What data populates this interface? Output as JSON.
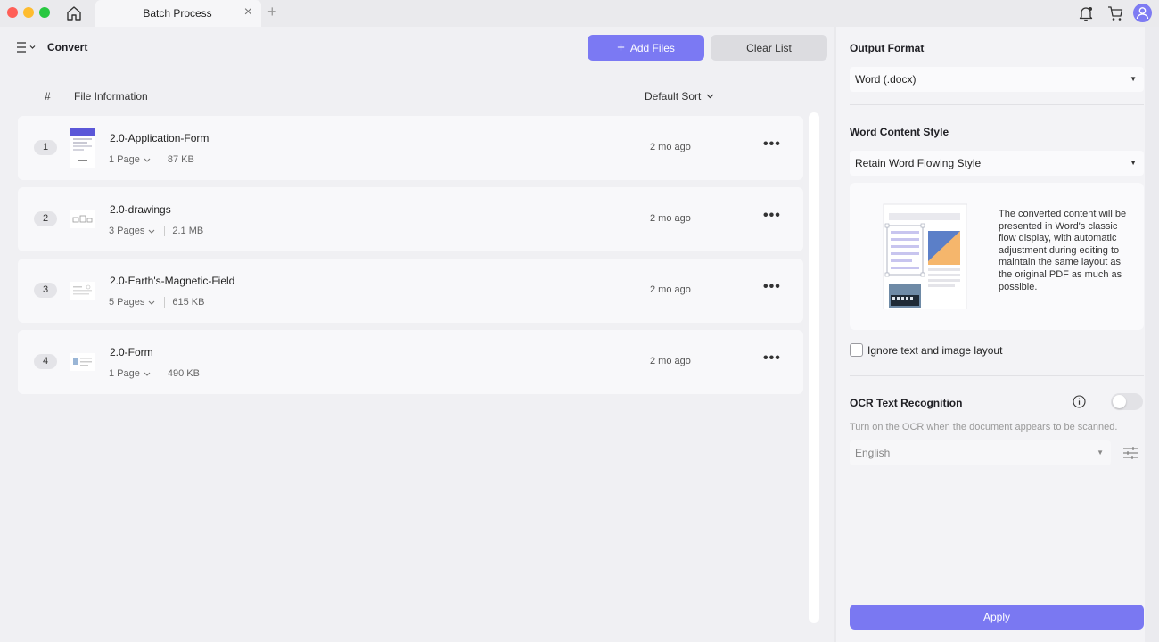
{
  "titlebar": {
    "tab_label": "Batch Process",
    "tab_close": "×",
    "tab_add": "+"
  },
  "main": {
    "title": "Convert",
    "add_files_label": "Add Files",
    "add_files_plus": "+",
    "clear_list_label": "Clear List",
    "columns": {
      "number": "#",
      "info": "File Information",
      "sort": "Default Sort"
    },
    "files": [
      {
        "index": "1",
        "name": "2.0-Application-Form",
        "pages": "1 Page",
        "size": "87 KB",
        "date": "2 mo ago"
      },
      {
        "index": "2",
        "name": "2.0-drawings",
        "pages": "3 Pages",
        "size": "2.1 MB",
        "date": "2 mo ago"
      },
      {
        "index": "3",
        "name": "2.0-Earth's-Magnetic-Field",
        "pages": "5 Pages",
        "size": "615 KB",
        "date": "2 mo ago"
      },
      {
        "index": "4",
        "name": "2.0-Form",
        "pages": "1 Page",
        "size": "490 KB",
        "date": "2 mo ago"
      }
    ],
    "more_glyph": "•••"
  },
  "side": {
    "output_format_title": "Output Format",
    "output_format_value": "Word (.docx)",
    "content_style_title": "Word Content Style",
    "content_style_value": "Retain Word Flowing Style",
    "content_style_description": "The converted content will be presented in Word's classic flow display, with automatic adjustment during editing to maintain the same layout as the original PDF as much as possible.",
    "ignore_layout_label": "Ignore text and image layout",
    "ignore_layout_checked": false,
    "ocr_title": "OCR Text Recognition",
    "ocr_enabled": false,
    "ocr_hint": "Turn on the OCR when the document appears to be scanned.",
    "ocr_language": "English",
    "apply_label": "Apply",
    "caret": "▼"
  },
  "colors": {
    "accent": "#7b79f3",
    "close": "#ff5f57",
    "minimize": "#febc2e",
    "maximize": "#28c840"
  }
}
